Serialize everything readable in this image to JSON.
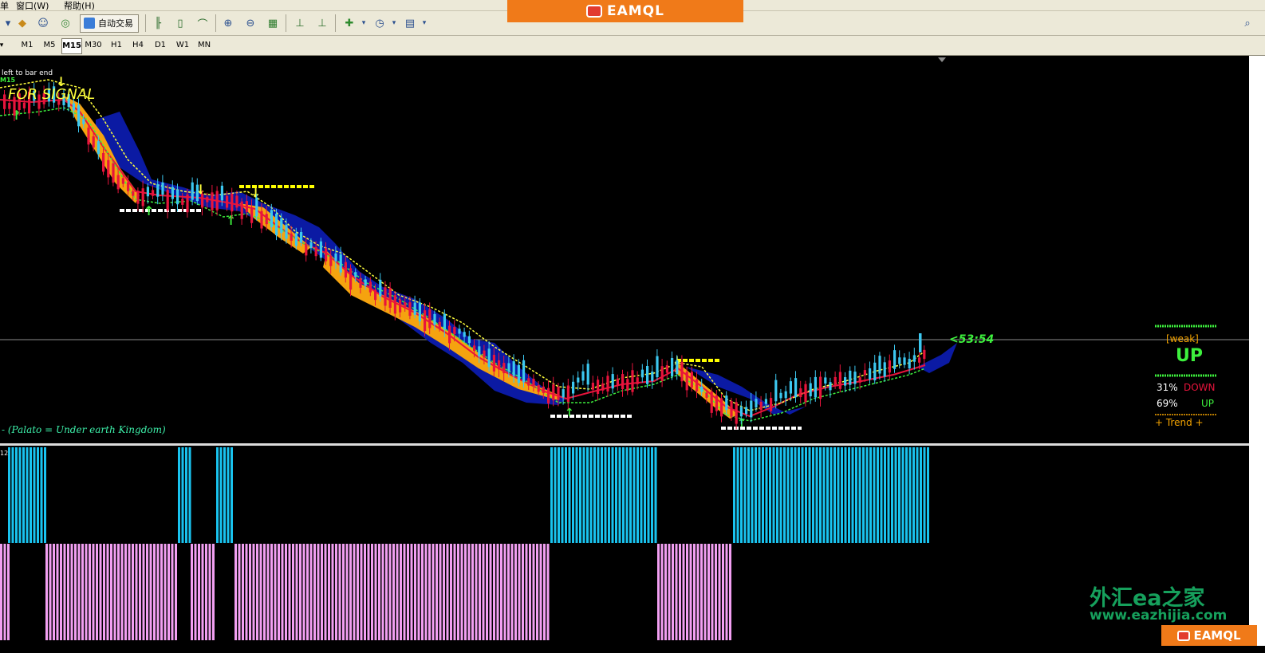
{
  "menu": {
    "item_left": "单",
    "window": "窗口(W)",
    "help": "帮助(H)"
  },
  "toolbar": {
    "auto_trade_label": "自动交易"
  },
  "timeframes": [
    "M1",
    "M5",
    "M15",
    "M30",
    "H1",
    "H4",
    "D1",
    "W1",
    "MN"
  ],
  "active_timeframe": "M15",
  "banner": {
    "text": "EAMQL",
    "color": "#f07a19"
  },
  "chart": {
    "top_left_label": "left to bar end",
    "timeframe_label": "M15",
    "signal_text": "FOR SIGNAL",
    "indicator_note": "- (Palato = Under earth Kingdom)",
    "countdown": "<53:54",
    "subwindow_label": "12"
  },
  "trend_panel": {
    "strength": "[weak]",
    "direction": "UP",
    "down_pct": "31%",
    "down_label": "DOWN",
    "up_pct": "69%",
    "up_label": "UP",
    "trend_label": "+ Trend +"
  },
  "watermark": {
    "cn": "外汇ea之家",
    "url": "www.eazhijia.com"
  },
  "bottom_logo": "EAMQL",
  "colors": {
    "bull": "#3cc8f0",
    "bear": "#e8143c",
    "histo_up": "#19c3ef",
    "histo_down": "#f29ff2",
    "cloud": "#0b1aa3"
  }
}
